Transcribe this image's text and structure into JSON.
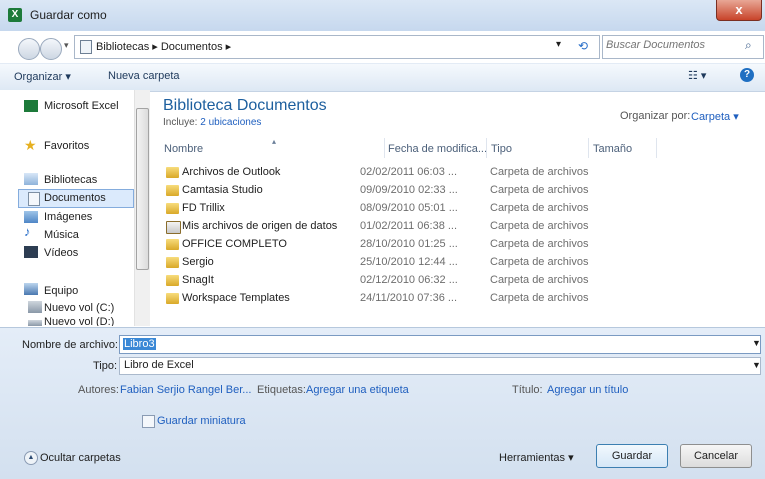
{
  "window": {
    "title": "Guardar como",
    "app_icon_letter": "X",
    "close_glyph": "x"
  },
  "address": {
    "crumbs": "Bibliotecas  ▸  Documentos  ▸",
    "search_placeholder": "Buscar Documentos"
  },
  "toolbar": {
    "organize": "Organizar ▾",
    "new_folder": "Nueva carpeta",
    "view": "▾"
  },
  "nav": {
    "items": [
      {
        "label": "Microsoft Excel"
      },
      {
        "label": "Favoritos"
      },
      {
        "label": "Bibliotecas"
      },
      {
        "label": "Documentos"
      },
      {
        "label": "Imágenes"
      },
      {
        "label": "Música"
      },
      {
        "label": "Vídeos"
      },
      {
        "label": "Equipo"
      },
      {
        "label": "Nuevo vol (C:)"
      },
      {
        "label": "Nuevo vol (D:)"
      }
    ]
  },
  "library": {
    "title": "Biblioteca Documentos",
    "includes_label": "Incluye:",
    "includes_link": "2 ubicaciones",
    "arrange_label": "Organizar por:",
    "arrange_value": "Carpeta ▾"
  },
  "columns": {
    "name": "Nombre",
    "date": "Fecha de modifica...",
    "type": "Tipo",
    "size": "Tamaño"
  },
  "files": [
    {
      "name": "Archivos de Outlook",
      "date": "02/02/2011 06:03 ...",
      "type": "Carpeta de archivos"
    },
    {
      "name": "Camtasia Studio",
      "date": "09/09/2010 02:33 ...",
      "type": "Carpeta de archivos"
    },
    {
      "name": "FD Trillix",
      "date": "08/09/2010 05:01 ...",
      "type": "Carpeta de archivos"
    },
    {
      "name": "Mis archivos de origen de datos",
      "date": "01/02/2011 06:38 ...",
      "type": "Carpeta de archivos"
    },
    {
      "name": "OFFICE COMPLETO",
      "date": "28/10/2010 01:25 ...",
      "type": "Carpeta de archivos"
    },
    {
      "name": "Sergio",
      "date": "25/10/2010 12:44 ...",
      "type": "Carpeta de archivos"
    },
    {
      "name": "SnagIt",
      "date": "02/12/2010 06:32 ...",
      "type": "Carpeta de archivos"
    },
    {
      "name": "Workspace Templates",
      "date": "24/11/2010 07:36 ...",
      "type": "Carpeta de archivos"
    }
  ],
  "form": {
    "filename_label": "Nombre de archivo:",
    "filename_value": "Libro3",
    "type_label": "Tipo:",
    "type_value": "Libro de Excel",
    "authors_label": "Autores:",
    "authors_value": "Fabian Serjio Rangel Ber...",
    "tags_label": "Etiquetas:",
    "tags_value": "Agregar una etiqueta",
    "title_label": "Título:",
    "title_value": "Agregar un título",
    "thumbnail_label": "Guardar miniatura"
  },
  "footer": {
    "hide_folders": "Ocultar carpetas",
    "tools": "Herramientas ▾",
    "save": "Guardar",
    "cancel": "Cancelar"
  }
}
